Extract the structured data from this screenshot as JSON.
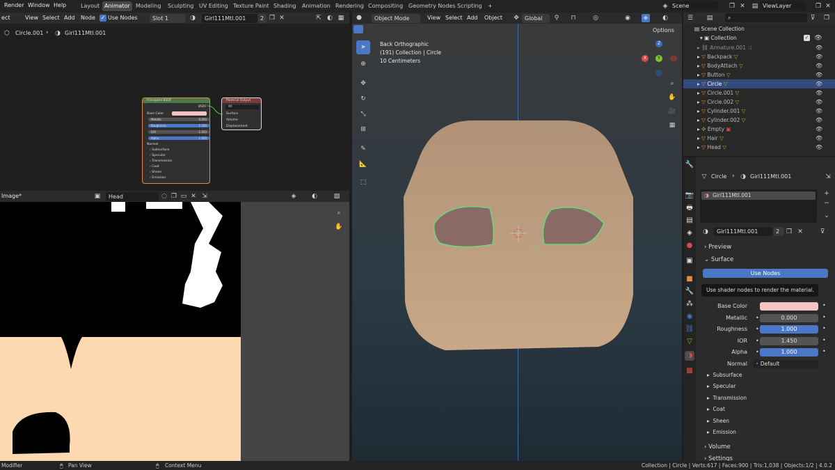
{
  "menus": [
    "Render",
    "Window",
    "Help"
  ],
  "workspaces": [
    {
      "label": "Layout"
    },
    {
      "label": "Animator",
      "active": true
    },
    {
      "label": "Modeling"
    },
    {
      "label": "Sculpting"
    },
    {
      "label": "UV Editing"
    },
    {
      "label": "Texture Paint"
    },
    {
      "label": "Shading"
    },
    {
      "label": "Animation"
    },
    {
      "label": "Rendering"
    },
    {
      "label": "Compositing"
    },
    {
      "label": "Geometry Nodes"
    },
    {
      "label": "Scripting"
    }
  ],
  "add_workspace": "+",
  "scene": "Scene",
  "view_layer": "ViewLayer",
  "node_editor": {
    "menu": [
      "ect",
      "View",
      "Select",
      "Add",
      "Node"
    ],
    "use_nodes": "Use Nodes",
    "slot": "Slot 1",
    "material": "Girl111Mtl.001",
    "users": "2",
    "breadcrumb": {
      "object": "Circle.001",
      "material": "Girl111Mtl.001"
    },
    "bsdf": {
      "title": "Principled BSDF",
      "out": "BSDF",
      "base_color": "Base Color",
      "metallic": "Metallic",
      "metallic_val": "0.000",
      "roughness": "Roughness",
      "roughness_val": "1.000",
      "ior": "IOR",
      "ior_val": "1.450",
      "alpha": "Alpha",
      "alpha_val": "1.000",
      "normal": "Normal",
      "subs": [
        "Subsurface",
        "Specular",
        "Transmission",
        "Coat",
        "Sheen",
        "Emission"
      ]
    },
    "output": {
      "title": "Material Output",
      "target": "All",
      "inputs": [
        "Surface",
        "Volume",
        "Displacement"
      ]
    }
  },
  "image_editor": {
    "title": "Image*",
    "image": "Head"
  },
  "viewport": {
    "mode": "Object Mode",
    "menus": [
      "View",
      "Select",
      "Add",
      "Object"
    ],
    "transform": "Global",
    "options": "Options",
    "info": [
      "Back Orthographic",
      "(191) Collection | Circle",
      "10 Centimeters"
    ],
    "gizmo": {
      "z": "Z",
      "x": "X",
      "y": "Y"
    }
  },
  "outliner": {
    "scene_collection": "Scene Collection",
    "collection": "Collection",
    "items": [
      "Armature.001",
      "Backpack",
      "BodyAttach",
      "Button",
      "Circle",
      "Circle.001",
      "Circle.002",
      "Cylinder.001",
      "Cylinder.002",
      "Empty",
      "Hair",
      "Head"
    ],
    "selected": "Circle"
  },
  "properties": {
    "object": "Circle",
    "material": "Girl111Mtl.001",
    "slot": "Girl111Mtl.001",
    "mat_field": "Girl111Mtl.001",
    "users": "2",
    "preview": "Preview",
    "surface": "Surface",
    "use_nodes": "Use Nodes",
    "tooltip": "Use shader nodes to render the material.",
    "base_color": "Base Color",
    "metallic": "Metallic",
    "metallic_val": "0.000",
    "roughness": "Roughness",
    "roughness_val": "1.000",
    "ior": "IOR",
    "ior_val": "1.450",
    "alpha": "Alpha",
    "alpha_val": "1.000",
    "normal": "Normal",
    "normal_val": "Default",
    "subs": [
      "Subsurface",
      "Specular",
      "Transmission",
      "Coat",
      "Sheen",
      "Emission"
    ],
    "volume": "Volume",
    "settings": "Settings"
  },
  "status": {
    "left": "Modifier",
    "pan": "Pan View",
    "context": "Context Menu",
    "right": "Collection | Circle | Verts:617 | Faces:900 | Tris:1,038 | Objects:1/2 | 4.0.2"
  },
  "colors": {
    "base_color": "#f4c4c4",
    "accent_blue": "#4a78c7",
    "selection": "#334a7c",
    "skin": "#fcd9b0",
    "face": "#b89a7c"
  }
}
